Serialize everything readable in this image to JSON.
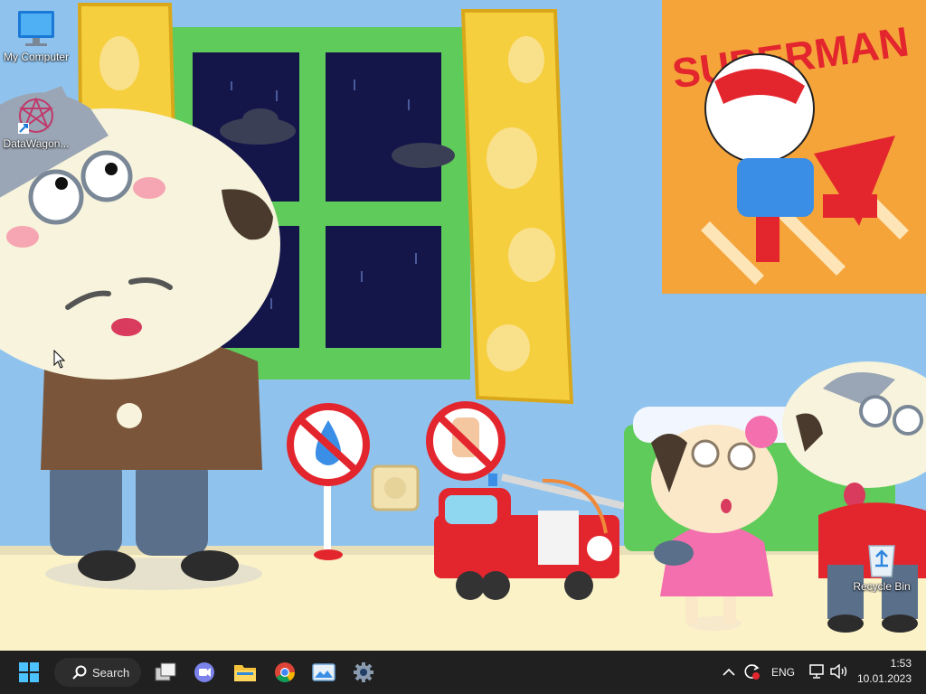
{
  "desktop": {
    "icons": [
      {
        "label": "My Computer",
        "icon": "monitor-icon"
      },
      {
        "label": "DataWagon...",
        "icon": "datawagon-shortcut-icon"
      },
      {
        "label": "Recycle Bin",
        "icon": "recycle-bin-icon"
      }
    ],
    "wallpaper": {
      "poster_text": "SUPERMAN"
    }
  },
  "taskbar": {
    "search_label": "Search",
    "pinned": [
      {
        "name": "start",
        "icon": "windows-start-icon"
      },
      {
        "name": "task-view",
        "icon": "task-view-icon"
      },
      {
        "name": "teams-chat",
        "icon": "teams-chat-icon"
      },
      {
        "name": "file-explorer",
        "icon": "file-explorer-icon"
      },
      {
        "name": "chrome",
        "icon": "chrome-icon"
      },
      {
        "name": "photos",
        "icon": "photos-icon"
      },
      {
        "name": "settings",
        "icon": "settings-gear-icon"
      }
    ],
    "tray": {
      "language": "ENG",
      "time": "1:53",
      "date": "10.01.2023"
    }
  },
  "colors": {
    "taskbar_bg": "#202020",
    "wall_blue": "#8fc3ee",
    "window_frame_green": "#5fcb5a",
    "curtain_yellow": "#f6cf3f",
    "poster_orange": "#f5a43a",
    "accent_blue": "#3b8ee6"
  }
}
